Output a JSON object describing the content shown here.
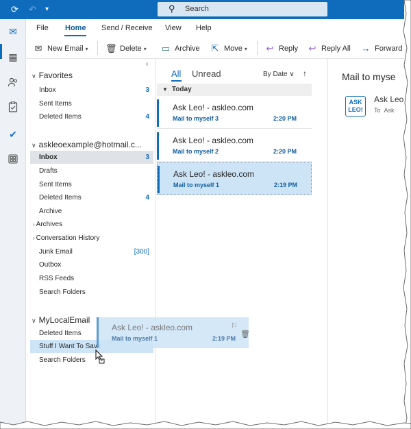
{
  "titlebar": {
    "search_placeholder": "Search",
    "icons": [
      "sync-icon",
      "undo-icon",
      "quick-access-dropdown-icon"
    ]
  },
  "menu": {
    "items": [
      "File",
      "Home",
      "Send / Receive",
      "View",
      "Help"
    ],
    "active": "Home"
  },
  "ribbon": {
    "new_email": "New Email",
    "delete": "Delete",
    "archive": "Archive",
    "move": "Move",
    "reply": "Reply",
    "reply_all": "Reply All",
    "forward": "Forward"
  },
  "folders": {
    "favorites": {
      "label": "Favorites",
      "items": [
        {
          "label": "Inbox",
          "count": "3"
        },
        {
          "label": "Sent Items",
          "count": ""
        },
        {
          "label": "Deleted Items",
          "count": "4"
        }
      ]
    },
    "account": {
      "label": "askleoexample@hotmail.c...",
      "items": [
        {
          "label": "Inbox",
          "count": "3"
        },
        {
          "label": "Drafts",
          "count": ""
        },
        {
          "label": "Sent Items",
          "count": ""
        },
        {
          "label": "Deleted Items",
          "count": "4"
        },
        {
          "label": "Archive",
          "count": ""
        },
        {
          "label": "Archives",
          "count": ""
        },
        {
          "label": "Conversation History",
          "count": ""
        },
        {
          "label": "Junk Email",
          "count": "[300]"
        },
        {
          "label": "Outbox",
          "count": ""
        },
        {
          "label": "RSS Feeds",
          "count": ""
        },
        {
          "label": "Search Folders",
          "count": ""
        }
      ]
    },
    "local": {
      "label": "MyLocalEmail",
      "items": [
        {
          "label": "Deleted Items",
          "count": ""
        },
        {
          "label": "Stuff I Want To Save",
          "count": ""
        },
        {
          "label": "Search Folders",
          "count": ""
        }
      ]
    }
  },
  "message_list": {
    "tab_all": "All",
    "tab_unread": "Unread",
    "sort_label": "By Date",
    "group_label": "Today",
    "messages": [
      {
        "from": "Ask Leo! - askleo.com",
        "subject": "Mail to myself 3",
        "time": "2:20 PM"
      },
      {
        "from": "Ask Leo! - askleo.com",
        "subject": "Mail to myself 2",
        "time": "2:20 PM"
      },
      {
        "from": "Ask Leo! - askleo.com",
        "subject": "Mail to myself 1",
        "time": "2:19 PM"
      }
    ]
  },
  "reading": {
    "title": "Mail to myse",
    "logo_line1": "ASK",
    "logo_line2": "LEO!",
    "sender": "Ask Leo",
    "to_label": "To",
    "to_value": "Ask"
  },
  "drag_ghost": {
    "from": "Ask Leo! - askleo.com",
    "subject": "Mail to myself 1",
    "time": "2:19 PM"
  },
  "colors": {
    "accent": "#0f6cbd",
    "selection": "#cde4f7",
    "titlebar": "#0f6cbd"
  }
}
